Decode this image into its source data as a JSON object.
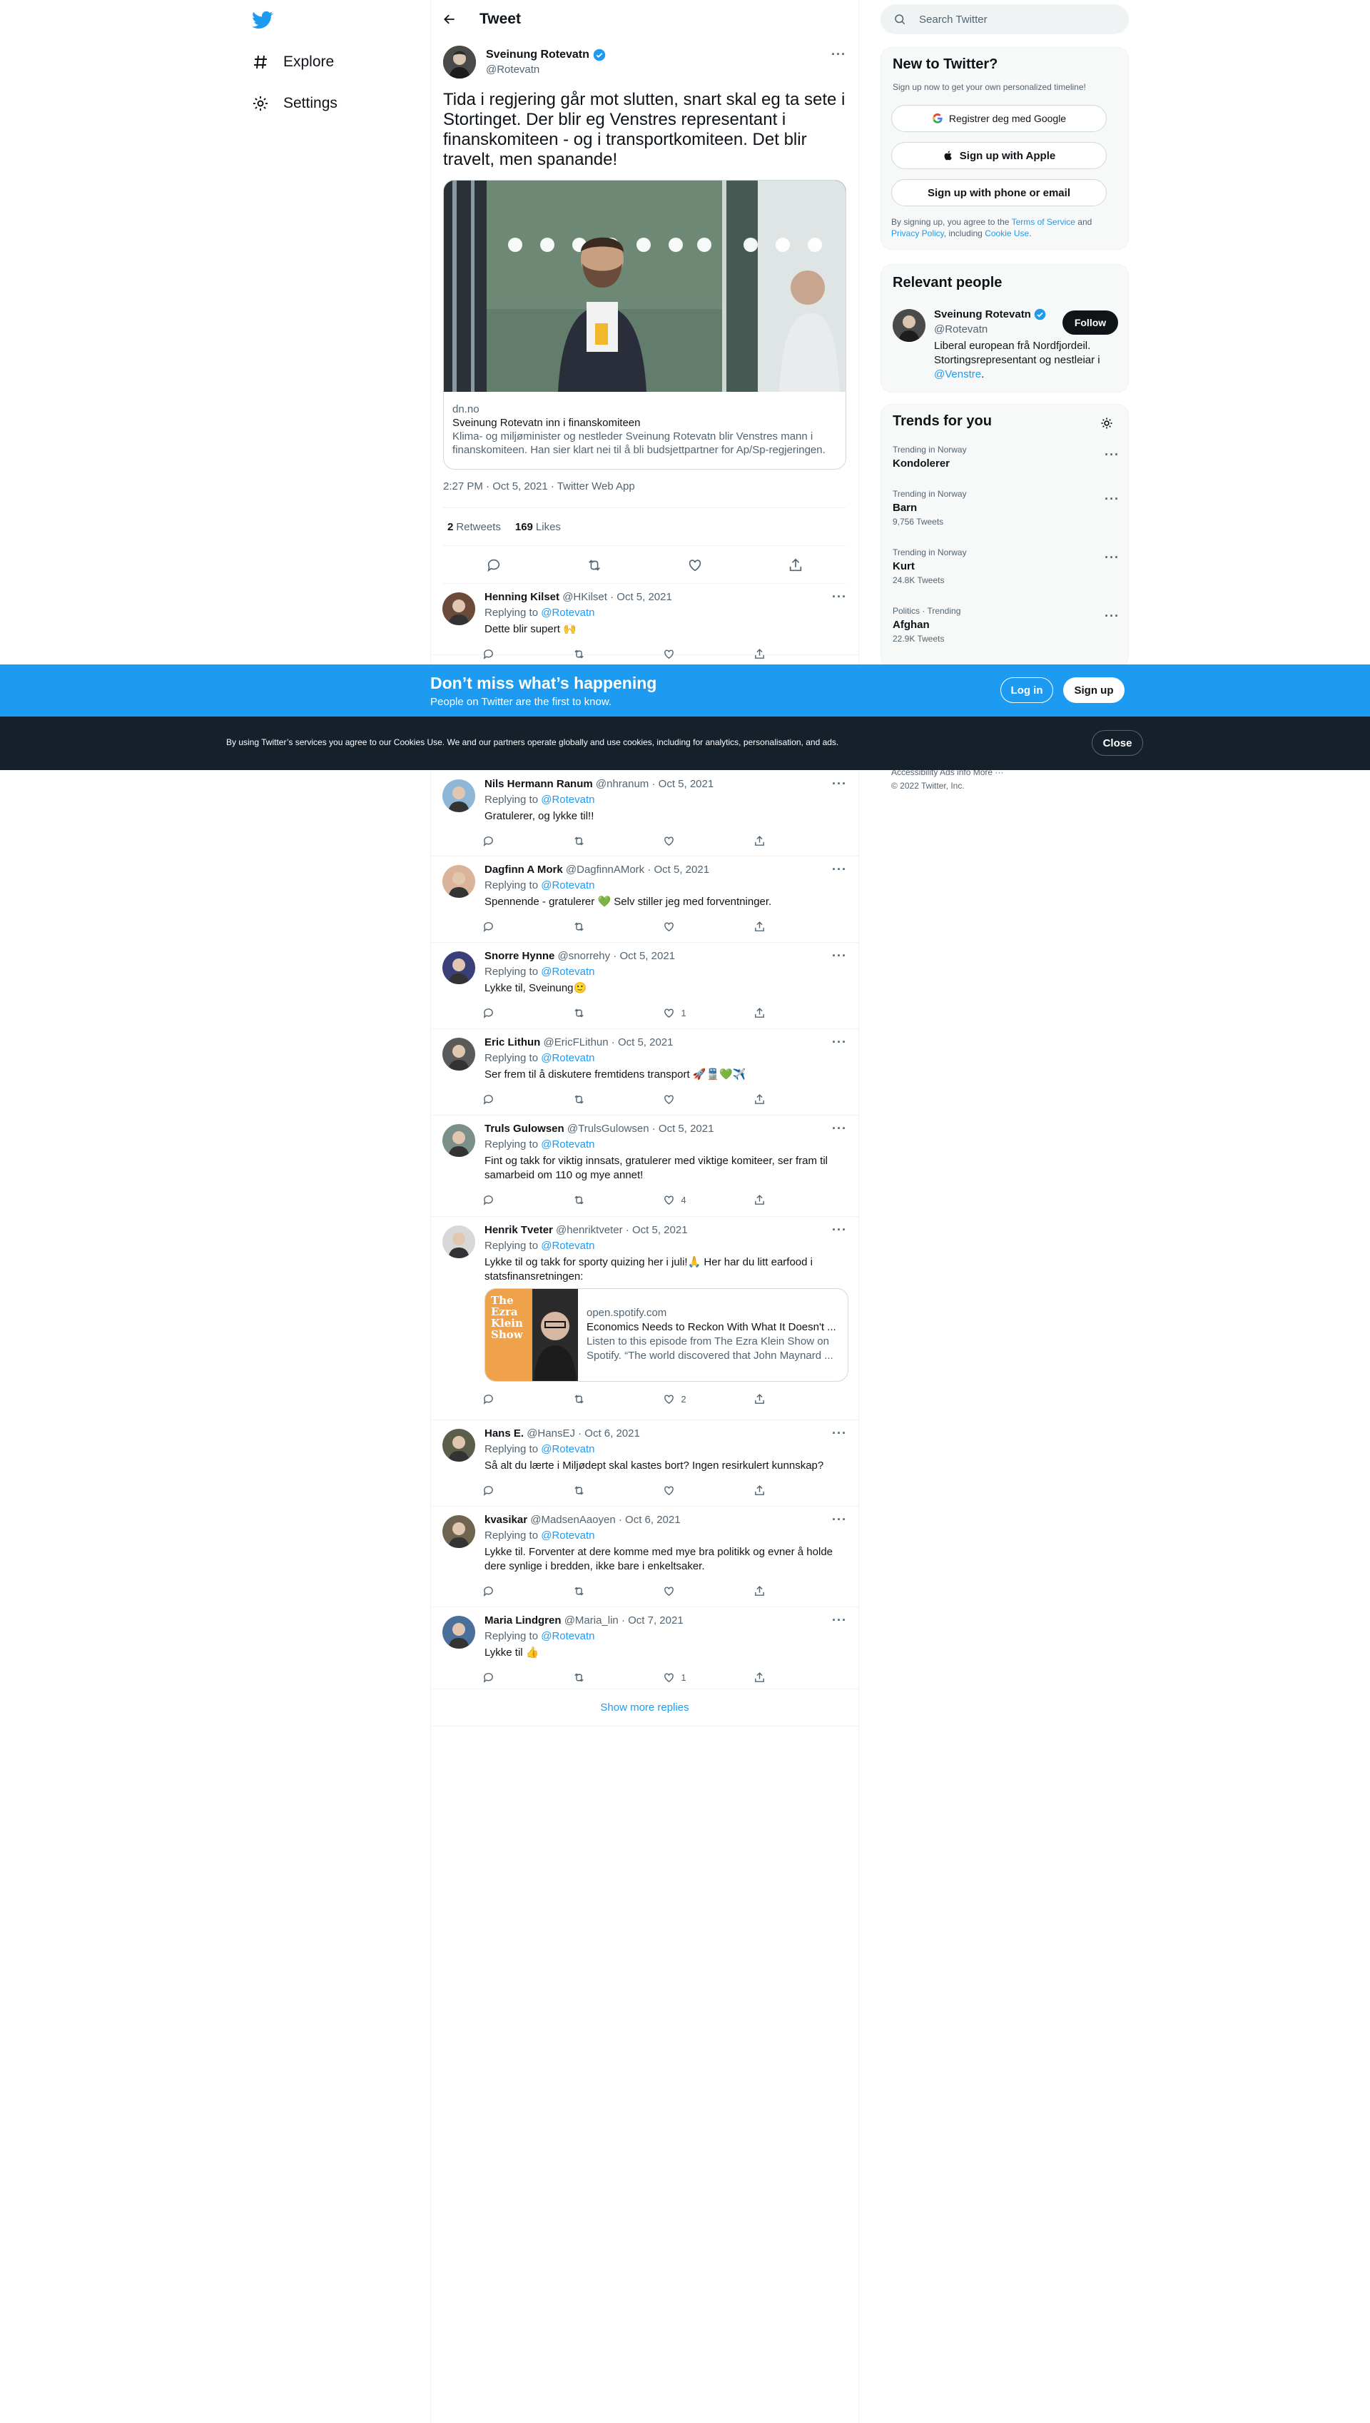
{
  "nav": {
    "explore": "Explore",
    "settings": "Settings"
  },
  "header": {
    "title": "Tweet"
  },
  "tweet": {
    "author_name": "Sveinung Rotevatn",
    "author_handle": "@Rotevatn",
    "text": "Tida i regjering går mot slutten, snart skal eg ta sete i Stortinget. Der blir eg Venstres representant i finanskomiteen - og i transportkomiteen. Det blir travelt, men spanande!",
    "card": {
      "domain": "dn.no",
      "title": "Sveinung Rotevatn inn i finanskomiteen",
      "description": "Klima- og miljøminister og nestleder Sveinung Rotevatn blir Venstres mann i finanskomiteen. Han sier klart nei til å bli budsjettpartner for Ap/Sp-regjeringen."
    },
    "timestamp": "2:27 PM · Oct 5, 2021 · Twitter Web App",
    "retweets_count": "2",
    "retweets_label": "Retweets",
    "likes_count": "169",
    "likes_label": "Likes"
  },
  "replies": [
    {
      "name": "Henning Kilset",
      "handle": "@HKilset",
      "date": "· Oct 5, 2021",
      "replying": "Replying to",
      "to": "@Rotevatn",
      "text": "Dette blir supert 🙌",
      "likes": ""
    },
    {
      "name": "Nils Hermann Ranum",
      "handle": "@nhranum",
      "date": "· Oct 5, 2021",
      "replying": "Replying to",
      "to": "@Rotevatn",
      "text": "Gratulerer, og lykke til!!",
      "likes": ""
    },
    {
      "name": "Dagfinn A Mork",
      "handle": "@DagfinnAMork",
      "date": "· Oct 5, 2021",
      "replying": "Replying to",
      "to": "@Rotevatn",
      "text": "Spennende - gratulerer 💚 Selv stiller jeg med forventninger.",
      "likes": ""
    },
    {
      "name": "Snorre Hynne",
      "handle": "@snorrehy",
      "date": "· Oct 5, 2021",
      "replying": "Replying to",
      "to": "@Rotevatn",
      "text": "Lykke til, Sveinung🙂",
      "likes": "1"
    },
    {
      "name": "Eric Lithun",
      "handle": "@EricFLithun",
      "date": "· Oct 5, 2021",
      "replying": "Replying to",
      "to": "@Rotevatn",
      "text": "Ser frem til å diskutere fremtidens transport 🚀🚆💚✈️",
      "likes": ""
    },
    {
      "name": "Truls Gulowsen",
      "handle": "@TrulsGulowsen",
      "date": "· Oct 5, 2021",
      "replying": "Replying to",
      "to": "@Rotevatn",
      "text": "Fint og takk for viktig innsats, gratulerer med viktige komiteer, ser fram til samarbeid om 110 og mye annet!",
      "likes": "4"
    },
    {
      "name": "Henrik Tveter",
      "handle": "@henriktveter",
      "date": "· Oct 5, 2021",
      "replying": "Replying to",
      "to": "@Rotevatn",
      "text": "Lykke til og takk for sporty quizing her i juli!🙏 Her har du litt earfood i statsfinansretningen:",
      "likes": "2",
      "card": {
        "domain": "open.spotify.com",
        "title": "Economics Needs to Reckon With What It Doesn't ...",
        "description": "Listen to this episode from The Ezra Klein Show on Spotify. “The world discovered that John Maynard ...",
        "art": "The Ezra Klein Show"
      }
    },
    {
      "name": "Hans E.",
      "handle": "@HansEJ",
      "date": "· Oct 6, 2021",
      "replying": "Replying to",
      "to": "@Rotevatn",
      "text": "Så alt du lærte i Miljødept skal kastes bort? Ingen resirkulert kunnskap?",
      "likes": ""
    },
    {
      "name": "kvasikar",
      "handle": "@MadsenAaoyen",
      "date": "· Oct 6, 2021",
      "replying": "Replying to",
      "to": "@Rotevatn",
      "text": "Lykke til. Forventer at dere komme med mye bra politikk og evner å holde dere synlige i bredden, ikke bare i enkeltsaker.",
      "likes": ""
    },
    {
      "name": "Maria Lindgren",
      "handle": "@Maria_lin",
      "date": "· Oct 7, 2021",
      "replying": "Replying to",
      "to": "@Rotevatn",
      "text": "Lykke til 👍",
      "likes": "1"
    }
  ],
  "show_more": "Show more replies",
  "sidebar": {
    "search_placeholder": "Search Twitter",
    "new_title": "New to Twitter?",
    "new_sub": "Sign up now to get your own personalized timeline!",
    "google_btn": "Registrer deg med Google",
    "apple_btn": "Sign up with Apple",
    "phone_btn": "Sign up with phone or email",
    "terms_pre": "By signing up, you agree to the",
    "terms_link": "Terms of Service",
    "terms_and": "and",
    "privacy_link": "Privacy Policy",
    "terms_incl": ", including",
    "cookie_link": "Cookie Use",
    "relevant_title": "Relevant people",
    "rel_name": "Sveinung Rotevatn",
    "rel_handle": "@Rotevatn",
    "follow_btn": "Follow",
    "rel_bio": "Liberal european frå Nordfjordeil. Stortingsrepresentant og nestleiar i",
    "rel_bio_link": "@Venstre",
    "trends_title": "Trends for you",
    "trends": [
      {
        "context": "Trending in Norway",
        "topic": "Kondolerer",
        "count": ""
      },
      {
        "context": "Trending in Norway",
        "topic": "Barn",
        "count": "9,756 Tweets"
      },
      {
        "context": "Trending in Norway",
        "topic": "Kurt",
        "count": "24.8K Tweets"
      },
      {
        "context": "Politics · Trending",
        "topic": "Afghan",
        "count": "22.9K Tweets"
      }
    ],
    "footer_links": "Accessibility   Ads info   More ···",
    "copyright": "© 2022 Twitter, Inc."
  },
  "banner": {
    "title": "Don’t miss what’s happening",
    "subtitle": "People on Twitter are the first to know.",
    "login": "Log in",
    "signup": "Sign up"
  },
  "cookie": {
    "text": "By using Twitter’s services you agree to our Cookies Use. We and our partners operate globally and use cookies, including for analytics, personalisation, and ads.",
    "close": "Close"
  },
  "colors": {
    "accent": "#1d9bf0",
    "dark": "#0f1419",
    "cookie_bg": "#15202b"
  }
}
